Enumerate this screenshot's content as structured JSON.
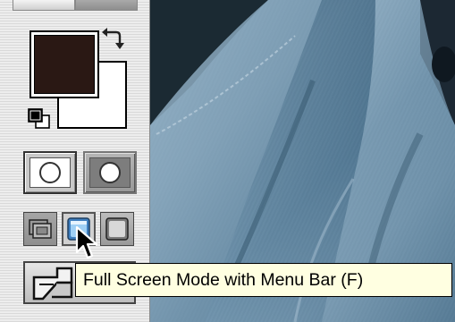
{
  "tooltip": {
    "text": "Full Screen Mode with Menu Bar (F)"
  },
  "colors": {
    "foreground": "#2a1814",
    "background": "#ffffff",
    "tooltip_bg": "#ffffe1"
  },
  "icons": {
    "swap": "swap-colors-icon",
    "default": "default-colors-icon",
    "standard_mode": "standard-mode-icon",
    "quick_mask": "quick-mask-icon",
    "standard_screen": "standard-screen-mode-icon",
    "fullscreen_menubar": "full-screen-with-menu-bar-icon",
    "fullscreen": "full-screen-mode-icon",
    "jump": "jump-to-imageready-icon",
    "cursor": "arrow-cursor-icon"
  }
}
